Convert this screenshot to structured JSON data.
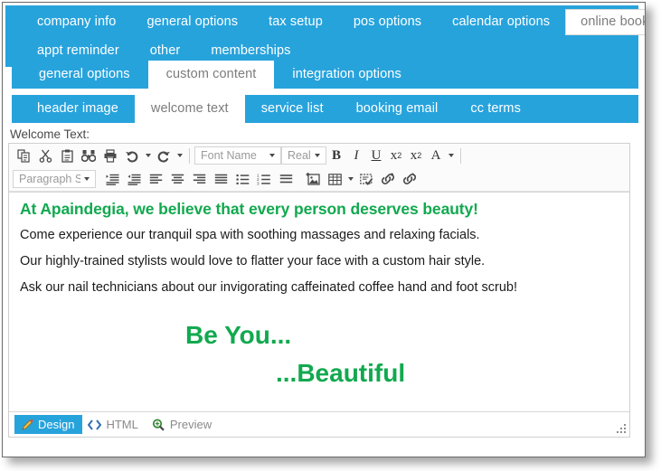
{
  "theme": {
    "accent_blue": "#27a3dc",
    "heading_green": "#11a94f",
    "tab_inactive_text": "#ffffff",
    "tab_active_text": "#7c7c7c"
  },
  "tabs_level1": {
    "row1": [
      {
        "label": "company info",
        "active": false
      },
      {
        "label": "general options",
        "active": false
      },
      {
        "label": "tax setup",
        "active": false
      },
      {
        "label": "pos options",
        "active": false
      },
      {
        "label": "calendar options",
        "active": false
      },
      {
        "label": "online booking",
        "active": true
      }
    ],
    "row2": [
      {
        "label": "appt reminder",
        "active": false
      },
      {
        "label": "other",
        "active": false
      },
      {
        "label": "memberships",
        "active": false
      }
    ]
  },
  "tabs_level2": [
    {
      "label": "general options",
      "active": false
    },
    {
      "label": "custom content",
      "active": true
    },
    {
      "label": "integration options",
      "active": false
    }
  ],
  "tabs_level3": [
    {
      "label": "header image",
      "active": false
    },
    {
      "label": "welcome text",
      "active": true
    },
    {
      "label": "service list",
      "active": false
    },
    {
      "label": "booking email",
      "active": false
    },
    {
      "label": "cc terms",
      "active": false
    }
  ],
  "editor": {
    "field_label": "Welcome Text:",
    "toolbar": {
      "row1_icons": [
        "copy-icon",
        "cut-icon",
        "paste-icon",
        "find-icon",
        "print-icon",
        "undo-icon",
        "redo-icon"
      ],
      "font_name_value": "Font Name",
      "font_size_value": "Real...",
      "bold_label": "B",
      "italic_label": "I",
      "underline_label": "U",
      "superscript_label": "x",
      "superscript_sup": "2",
      "subscript_label": "x",
      "subscript_sub": "2",
      "fontcolor_label": "A",
      "paragraph_style_value": "Paragraph St...",
      "row2_icons": [
        "indent-increase-icon",
        "indent-decrease-icon",
        "align-left-icon",
        "align-center-icon",
        "align-right-icon",
        "align-justify-icon",
        "bullet-list-icon",
        "numbered-list-icon",
        "line-spacing-icon",
        "insert-image-icon",
        "insert-table-icon",
        "spell-check-icon",
        "insert-link-icon",
        "remove-link-icon"
      ]
    },
    "document": {
      "heading": "At Apaindegia, we believe that every person deserves beauty!",
      "paragraphs": [
        "Come experience our tranquil spa with soothing massages and relaxing facials.",
        "Our highly-trained stylists would love to flatter your face with a custom hair style.",
        "Ask our nail technicians about our invigorating caffeinated coffee hand and foot scrub!"
      ],
      "tagline_line1": "Be You...",
      "tagline_line2": "...Beautiful"
    },
    "modes": [
      {
        "label": "Design",
        "icon": "pencil-icon",
        "active": true
      },
      {
        "label": "HTML",
        "icon": "code-icon",
        "active": false
      },
      {
        "label": "Preview",
        "icon": "magnifier-icon",
        "active": false
      }
    ]
  }
}
